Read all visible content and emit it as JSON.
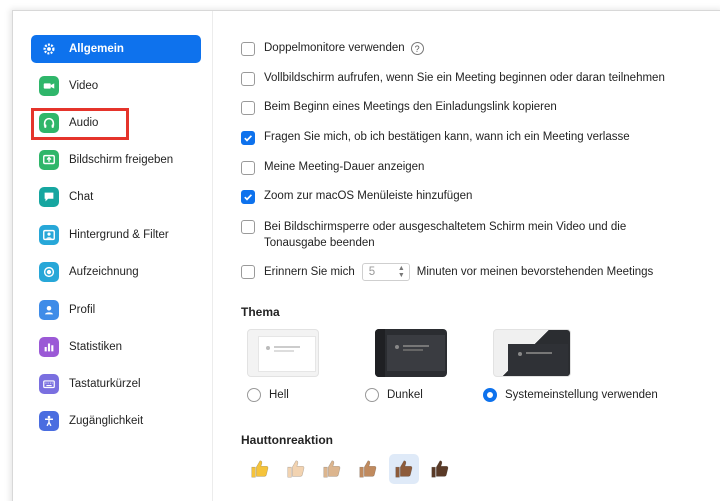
{
  "sidebar": {
    "items": [
      {
        "label": "Allgemein",
        "icon": "gear-icon",
        "color": "#0e72ed",
        "active": true
      },
      {
        "label": "Video",
        "icon": "video-camera-icon",
        "color": "#2fb66a"
      },
      {
        "label": "Audio",
        "icon": "headphones-icon",
        "color": "#2fb66a"
      },
      {
        "label": "Bildschirm freigeben",
        "icon": "share-screen-icon",
        "color": "#2fb66a"
      },
      {
        "label": "Chat",
        "icon": "chat-bubble-icon",
        "color": "#16a6a0"
      },
      {
        "label": "Hintergrund & Filter",
        "icon": "background-person-icon",
        "color": "#27a7d8"
      },
      {
        "label": "Aufzeichnung",
        "icon": "record-icon",
        "color": "#27a7d8"
      },
      {
        "label": "Profil",
        "icon": "user-profile-icon",
        "color": "#3f8ce8"
      },
      {
        "label": "Statistiken",
        "icon": "bar-chart-icon",
        "color": "#9b59d6"
      },
      {
        "label": "Tastaturkürzel",
        "icon": "keyboard-icon",
        "color": "#7a6fe0"
      },
      {
        "label": "Zugänglichkeit",
        "icon": "accessibility-icon",
        "color": "#4a6de0"
      }
    ]
  },
  "options": [
    {
      "label": "Doppelmonitore verwenden",
      "checked": false,
      "help": true
    },
    {
      "label": "Vollbildschirm aufrufen, wenn Sie ein Meeting beginnen oder daran teilnehmen",
      "checked": false
    },
    {
      "label": "Beim Beginn eines Meetings den Einladungslink kopieren",
      "checked": false
    },
    {
      "label": "Fragen Sie mich, ob ich bestätigen kann, wann ich ein Meeting verlasse",
      "checked": true
    },
    {
      "label": "Meine Meeting-Dauer anzeigen",
      "checked": false
    },
    {
      "label": "Zoom zur macOS Menüleiste hinzufügen",
      "checked": true
    },
    {
      "label_line1": "Bei Bildschirmsperre oder ausgeschaltetem Schirm mein Video und die",
      "label_line2": "Tonausgabe beenden",
      "checked": false
    }
  ],
  "reminder": {
    "prefix": "Erinnern Sie mich",
    "value": "5",
    "suffix": "Minuten vor meinen bevorstehenden Meetings",
    "checked": false
  },
  "help_symbol": "?",
  "theme": {
    "title": "Thema",
    "options": [
      {
        "label": "Hell",
        "selected": false
      },
      {
        "label": "Dunkel",
        "selected": false
      },
      {
        "label": "Systemeinstellung verwenden",
        "selected": true
      }
    ]
  },
  "skin_tone": {
    "title": "Hauttonreaktion",
    "tones": [
      "#f5c33b",
      "#f2d3b1",
      "#dcb58e",
      "#c08a5e",
      "#8d5b3a",
      "#5a3a27"
    ],
    "selected_index": 4
  },
  "colors": {
    "accent": "#0e72ed",
    "highlight": "#e5342b"
  }
}
